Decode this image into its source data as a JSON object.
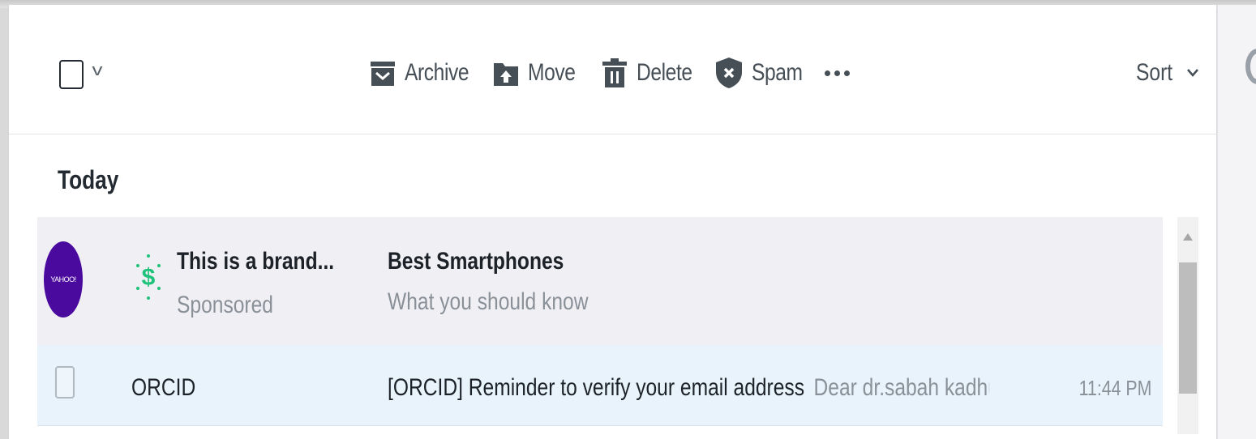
{
  "toolbar": {
    "archive_label": "Archive",
    "move_label": "Move",
    "delete_label": "Delete",
    "spam_label": "Spam",
    "sort_label": "Sort"
  },
  "section": {
    "title": "Today"
  },
  "ad": {
    "logo_text": "YAHOO!",
    "sender": "This is a brand...",
    "sponsored_label": "Sponsored",
    "subject": "Best Smartphones",
    "snippet": "What you should know"
  },
  "messages": [
    {
      "sender": "ORCID",
      "subject": "[ORCID] Reminder to verify your email address",
      "preview": "Dear dr.sabah kadhum, Th",
      "time": "11:44 PM"
    }
  ],
  "colors": {
    "accent_purple": "#4a0a9e",
    "sponsored_green": "#1fc27a",
    "selected_row": "#e8f3fc",
    "icon_gray": "#464e56"
  }
}
